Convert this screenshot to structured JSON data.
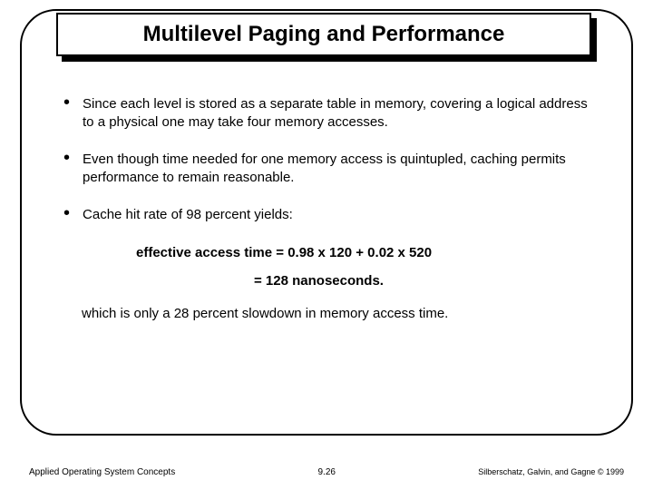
{
  "title": "Multilevel Paging and Performance",
  "bullets": [
    "Since each level is stored as a separate table in memory, covering a logical address to a physical one may take four memory accesses.",
    "Even though time needed for one memory access is quintupled, caching permits performance to remain reasonable.",
    "Cache hit rate of 98 percent yields:"
  ],
  "calc": {
    "line1": "effective access time = 0.98 x 120 + 0.02 x 520",
    "line2": "= 128 nanoseconds."
  },
  "closing": "which is only a 28 percent slowdown in memory access time.",
  "footer": {
    "left": "Applied Operating System Concepts",
    "center": "9.26",
    "right": "Silberschatz, Galvin, and Gagne © 1999"
  }
}
